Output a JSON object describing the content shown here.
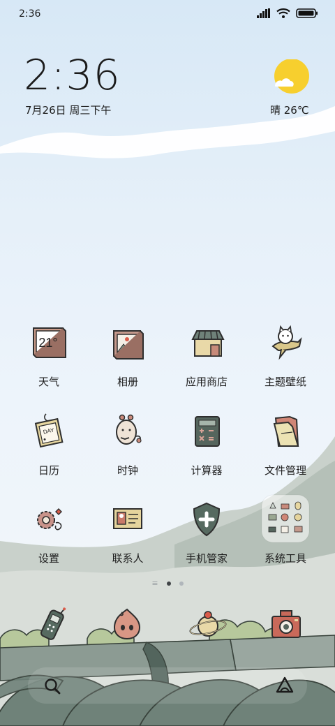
{
  "status_bar": {
    "time": "2:36"
  },
  "clock": {
    "time": "2:36",
    "date": "7月26日 周三下午"
  },
  "weather": {
    "text": "晴 26℃",
    "icon": "sun-behind-cloud"
  },
  "apps": [
    {
      "label": "天气",
      "icon": "weather-icon",
      "icon_text": "21°"
    },
    {
      "label": "相册",
      "icon": "gallery-icon"
    },
    {
      "label": "应用商店",
      "icon": "app-store-icon"
    },
    {
      "label": "主题壁纸",
      "icon": "themes-icon"
    },
    {
      "label": "日历",
      "icon": "calendar-icon",
      "icon_text": "DAY"
    },
    {
      "label": "时钟",
      "icon": "clock-icon"
    },
    {
      "label": "计算器",
      "icon": "calculator-icon"
    },
    {
      "label": "文件管理",
      "icon": "folder-icon"
    },
    {
      "label": "设置",
      "icon": "settings-icon"
    },
    {
      "label": "联系人",
      "icon": "contacts-icon"
    },
    {
      "label": "手机管家",
      "icon": "security-icon"
    },
    {
      "label": "系统工具",
      "icon": "system-tools-folder-icon"
    }
  ],
  "page_indicator": {
    "pages": 2,
    "active": 1
  },
  "dock": [
    {
      "icon": "phone-icon"
    },
    {
      "icon": "messages-icon"
    },
    {
      "icon": "browser-icon"
    },
    {
      "icon": "camera-icon"
    }
  ],
  "colors": {
    "sun": "#f7cf2e",
    "hill": "#8e9b93",
    "roof": "#6f8279",
    "shrub": "#9ab078"
  }
}
